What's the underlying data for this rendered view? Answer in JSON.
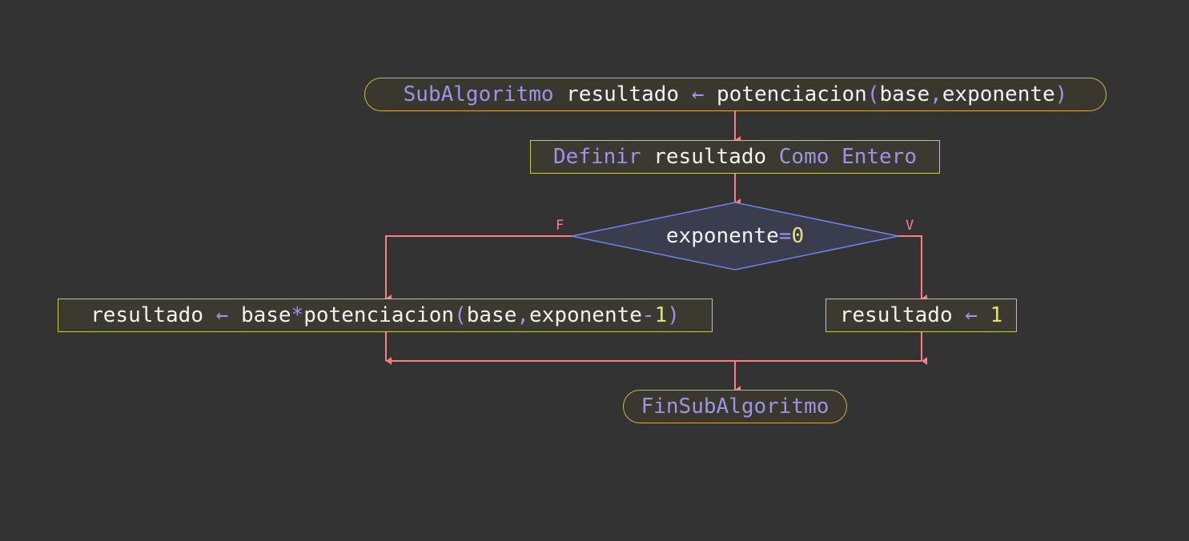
{
  "colors": {
    "background": "#333333",
    "arrow": "#ff7f7f",
    "keyword": "#9d93e8",
    "number": "#e6e07a",
    "text": "#f2f2f2",
    "terminal_border": "#d4b04a",
    "process_border": "#c9cc46",
    "decision_border": "#6f86e6",
    "decision_fill": "#3a3d4d"
  },
  "start": {
    "kw1": "SubAlgoritmo",
    "var": " resultado ",
    "arrow": "←",
    "fn": " potenciacion",
    "paren_open": "(",
    "arg1": "base",
    "comma": ",",
    "arg2": "exponente",
    "paren_close": ")"
  },
  "define": {
    "kw1": "Definir",
    "var": " resultado ",
    "kw2": "Como",
    "space": " ",
    "kw3": "Entero"
  },
  "decision": {
    "lhs": "exponente",
    "op": "=",
    "rhs": "0",
    "false_label": "F",
    "true_label": "V"
  },
  "false_branch": {
    "var": "resultado ",
    "arrow": "←",
    "t1": " base",
    "op": "*",
    "t2": "potenciacion",
    "paren_open": "(",
    "arg1": "base",
    "comma": ",",
    "arg2": "exponente",
    "minus": "-",
    "one": "1",
    "paren_close": ")"
  },
  "true_branch": {
    "var": "resultado ",
    "arrow": "←",
    "space": " ",
    "one": "1"
  },
  "end": {
    "kw": "FinSubAlgoritmo"
  }
}
